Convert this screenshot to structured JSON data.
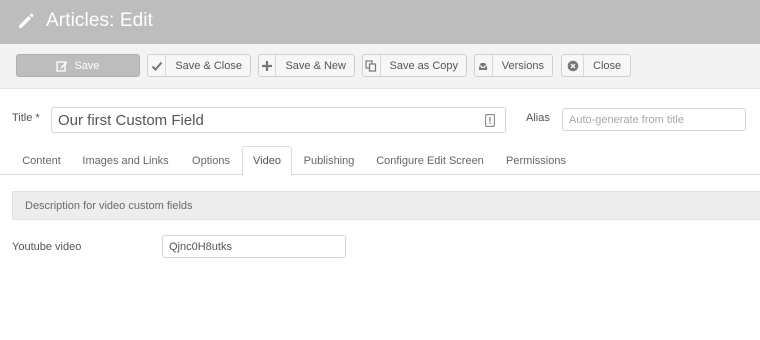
{
  "header": {
    "title": "Articles: Edit",
    "icon": "pencil-icon"
  },
  "toolbar": {
    "buttons": [
      {
        "label": "Save",
        "icon": "edit-icon"
      },
      {
        "label": "Save & Close",
        "icon": "check-icon"
      },
      {
        "label": "Save & New",
        "icon": "plus-icon"
      },
      {
        "label": "Save as Copy",
        "icon": "copy-icon"
      },
      {
        "label": "Versions",
        "icon": "archive-icon"
      },
      {
        "label": "Close",
        "icon": "cancel-circle-icon"
      }
    ]
  },
  "form": {
    "title_label": "Title *",
    "title_value": "Our first Custom Field",
    "alias_label": "Alias",
    "alias_placeholder": "Auto-generate from title"
  },
  "tabs": [
    {
      "label": "Content"
    },
    {
      "label": "Images and Links"
    },
    {
      "label": "Options"
    },
    {
      "label": "Video",
      "active": true
    },
    {
      "label": "Publishing"
    },
    {
      "label": "Configure Edit Screen"
    },
    {
      "label": "Permissions"
    }
  ],
  "video_tab": {
    "description": "Description for video custom fields",
    "youtube_label": "Youtube video",
    "youtube_value": "Qjnc0H8utks"
  },
  "colors": {
    "header_bg": "#bdbdbd",
    "save_button_bg": "#bdbdbd",
    "description_bg": "#ededed"
  }
}
